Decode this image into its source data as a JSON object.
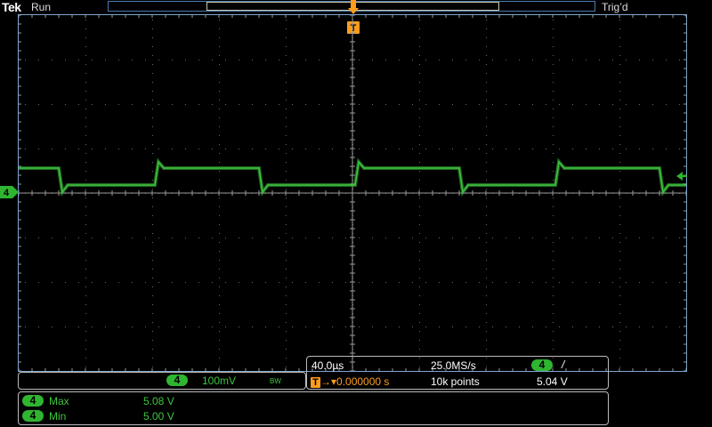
{
  "header": {
    "brand": "Tek",
    "run_state": "Run",
    "trigger_state": "Trig’d"
  },
  "markers": {
    "trigger_position_label": "T",
    "channel_ground_label": "4"
  },
  "vertical": {
    "channel": "4",
    "scale": "100mV",
    "bw_label": "BW"
  },
  "horizontal": {
    "time_div": "40.0µs",
    "sample_rate": "25.0MS/s",
    "trigger_channel": "4",
    "trigger_slope": "/",
    "trigger_label": "T",
    "trigger_delay": "0.000000 s",
    "record_length": "10k points",
    "trigger_level": "5.04 V"
  },
  "measurements": [
    {
      "channel": "4",
      "name": "Max",
      "value": "5.08 V"
    },
    {
      "channel": "4",
      "name": "Min",
      "value": "5.00 V"
    }
  ],
  "colors": {
    "trace": "#3ec43e",
    "trigger": "#ff9d1a",
    "graticule": "#7fa6cc"
  }
}
